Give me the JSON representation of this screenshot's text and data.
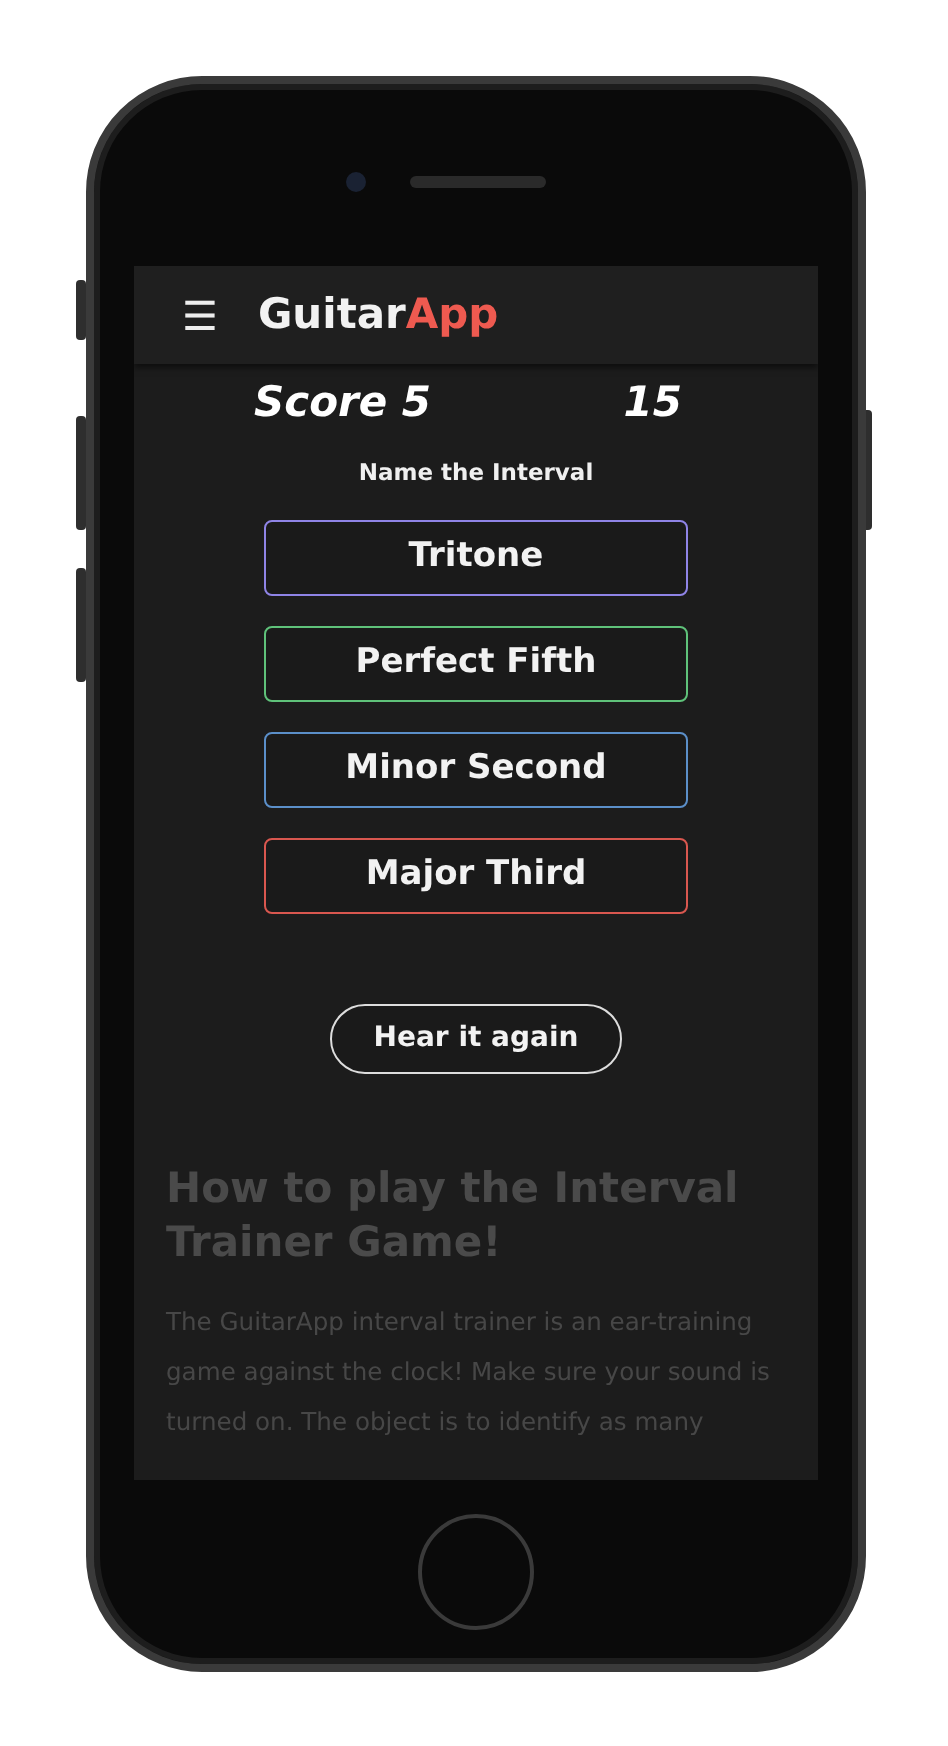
{
  "header": {
    "menu_icon": "☰",
    "brand": "Guitar",
    "brand_accent": "App"
  },
  "game": {
    "score": "Score 5",
    "timer": "15",
    "prompt": "Name the Interval",
    "answers": [
      {
        "label": "Tritone",
        "color": "#8f84e6"
      },
      {
        "label": "Perfect Fifth",
        "color": "#5fc27a"
      },
      {
        "label": "Minor Second",
        "color": "#5b8fc9"
      },
      {
        "label": "Major Third",
        "color": "#d9574f"
      }
    ],
    "replay_button": "Hear it again"
  },
  "instructions": {
    "title": "How to play the Interval Trainer Game!",
    "body": "The GuitarApp interval trainer is an ear-training game against the clock! Make sure your sound is turned on. The object is to identify as many"
  }
}
